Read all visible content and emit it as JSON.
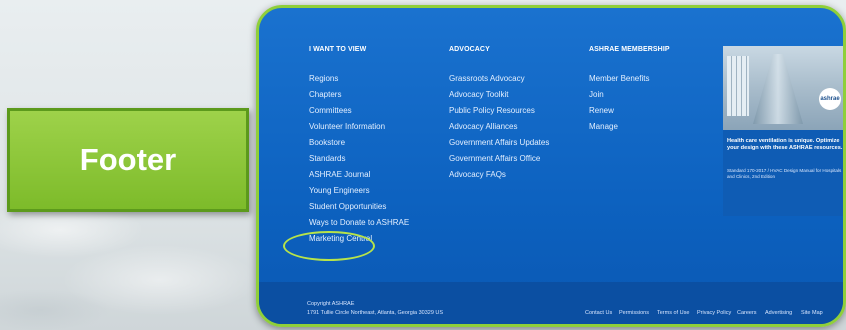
{
  "badge": {
    "label": "Footer"
  },
  "columns": [
    {
      "title": "I WANT TO VIEW",
      "links": [
        "Regions",
        "Chapters",
        "Committees",
        "Volunteer Information",
        "Bookstore",
        "Standards",
        "ASHRAE Journal",
        "Young Engineers",
        "Student Opportunities",
        "Ways to Donate to ASHRAE",
        "Marketing Central"
      ]
    },
    {
      "title": "ADVOCACY",
      "links": [
        "Grassroots Advocacy",
        "Advocacy Toolkit",
        "Public Policy Resources",
        "Advocacy Alliances",
        "Government Affairs Updates",
        "Government Affairs Office",
        "Advocacy FAQs"
      ]
    },
    {
      "title": "ASHRAE MEMBERSHIP",
      "links": [
        "Member Benefits",
        "Join",
        "Renew",
        "Manage"
      ]
    }
  ],
  "promo": {
    "logo": "ashrae",
    "headline": "Health care ventilation is unique. Optimize your design with these ASHRAE resources.",
    "subtext": "Standard 170-2017 / HVAC Design Manual for Hospitals and Clinics, 2nd Edition"
  },
  "footer": {
    "copyright_line1": "Copyright ASHRAE",
    "copyright_line2": "1791 Tullie Circle Northeast, Atlanta, Georgia 30329 US",
    "bottom_links": [
      "Contact Us",
      "Permissions",
      "Terms of Use",
      "Privacy Policy",
      "Careers",
      "Advertising",
      "Site Map"
    ]
  },
  "colors": {
    "panel_blue": "#0d62c0",
    "badge_green": "#7dbb2a",
    "border_green": "#8fcf3a",
    "highlight": "#b7e34a"
  }
}
